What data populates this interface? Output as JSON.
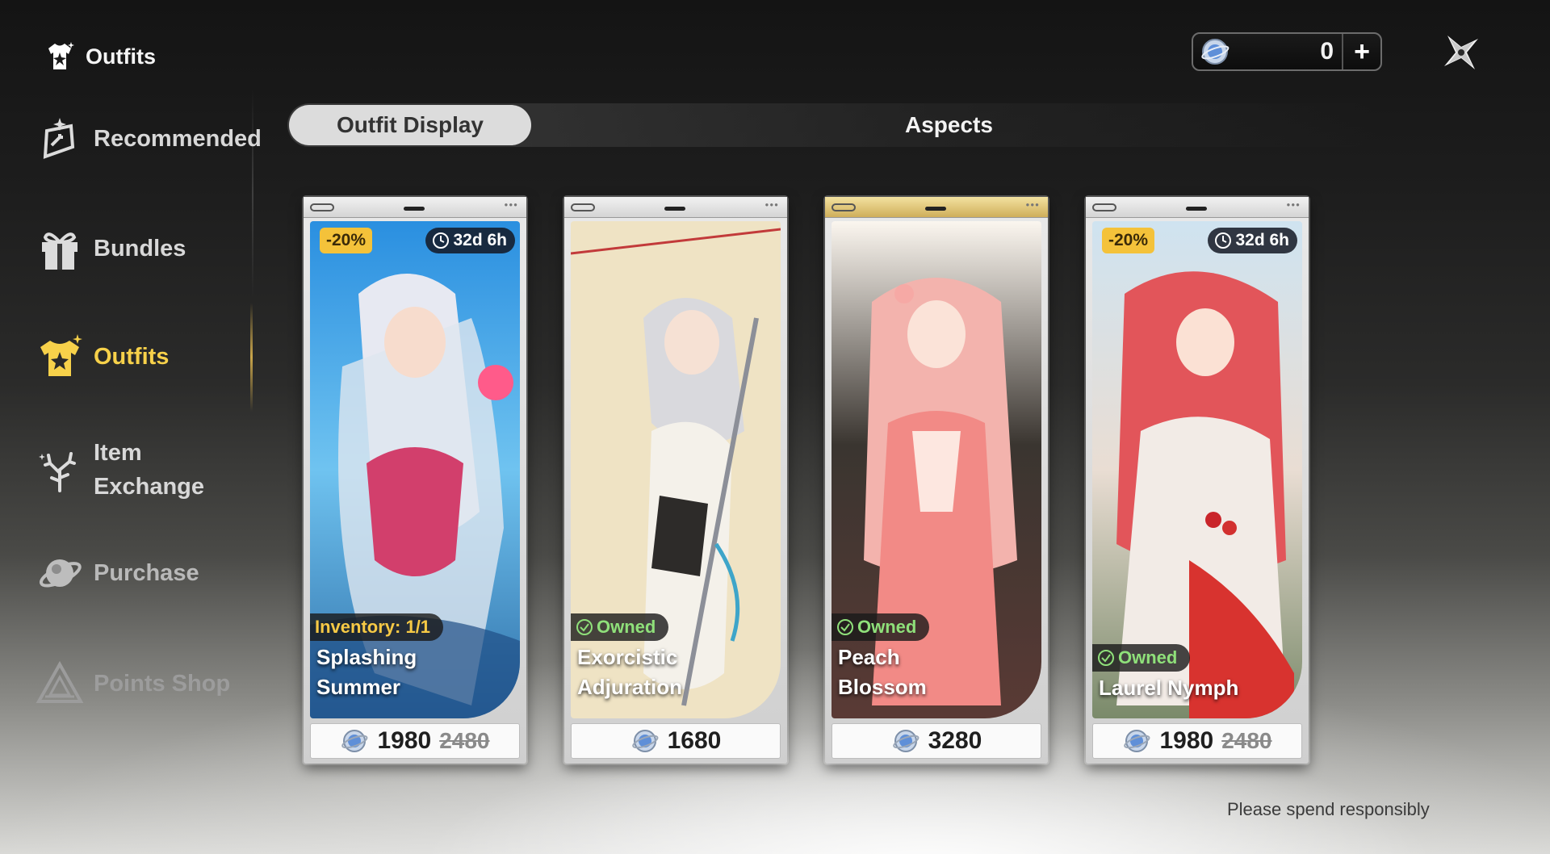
{
  "header": {
    "title": "Outfits",
    "currency_amount": "0"
  },
  "sidebar": {
    "items": [
      {
        "label": "Recommended",
        "icon": "recommended-icon"
      },
      {
        "label": "Bundles",
        "icon": "gift-icon"
      },
      {
        "label": "Outfits",
        "icon": "outfit-icon",
        "active": true
      },
      {
        "label": "Item",
        "label2": "Exchange",
        "icon": "coral-icon"
      },
      {
        "label": "Purchase",
        "icon": "planet-icon"
      },
      {
        "label": "Points Shop",
        "icon": "triangle-icon"
      }
    ]
  },
  "tabs": [
    {
      "label": "Outfit Display",
      "active": true
    },
    {
      "label": "Aspects",
      "active": false
    }
  ],
  "cards": [
    {
      "discount": "-20%",
      "timer": "32d 6h",
      "status": "Inventory: 1/1",
      "name1": "Splashing",
      "name2": "Summer",
      "price": "1980",
      "old_price": "2480"
    },
    {
      "status": "Owned",
      "name1": "Exorcistic",
      "name2": "Adjuration",
      "price": "1680"
    },
    {
      "status": "Owned",
      "name1": "Peach",
      "name2": "Blossom",
      "price": "3280"
    },
    {
      "discount": "-20%",
      "timer": "32d 6h",
      "status": "Owned",
      "name1": "Laurel Nymph",
      "price": "1980",
      "old_price": "2480"
    }
  ],
  "footer": {
    "note": "Please spend responsibly"
  },
  "colors": {
    "accent_gold": "#f7d14a",
    "discount": "#f4c23a",
    "owned": "#8fe07a"
  }
}
